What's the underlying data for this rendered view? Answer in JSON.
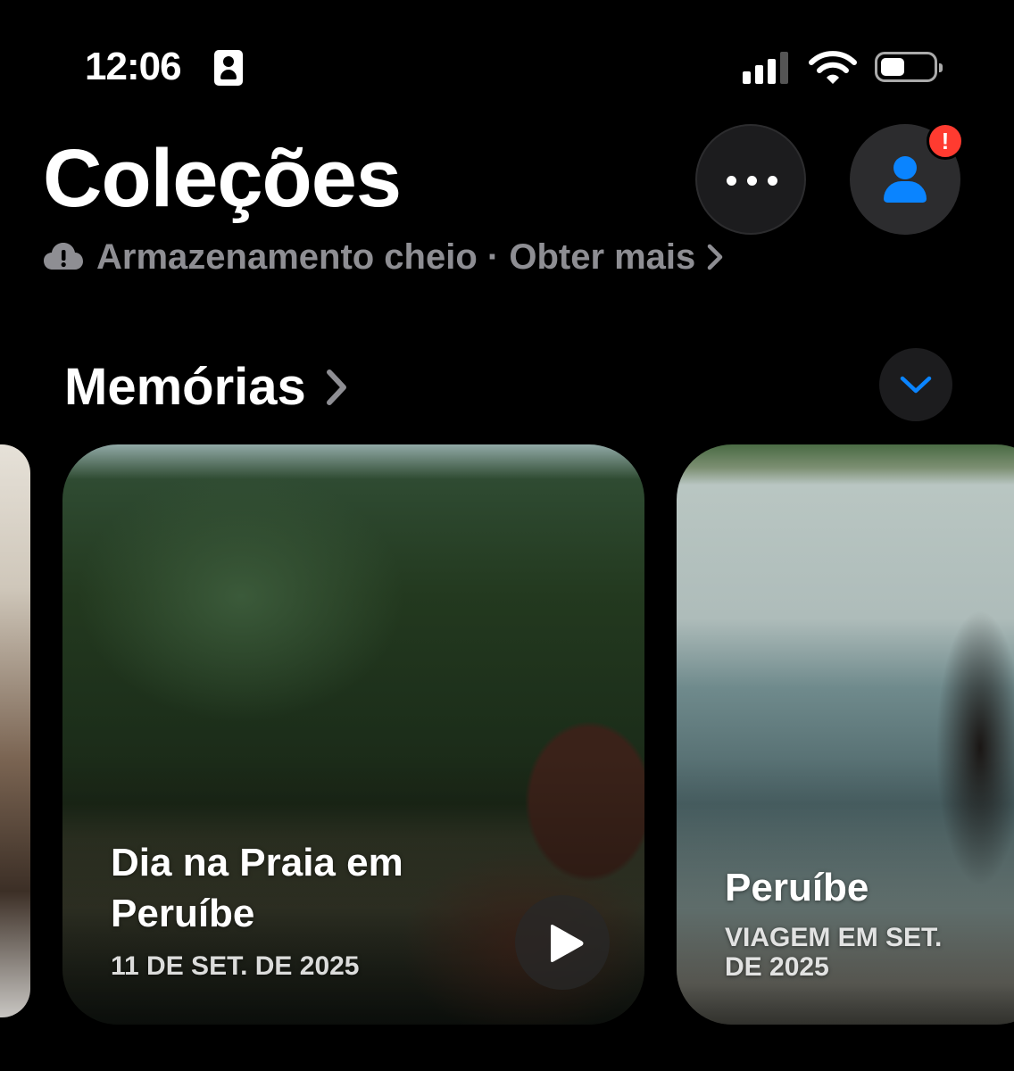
{
  "status_bar": {
    "time": "12:06",
    "icons": [
      "contact-card-icon",
      "cellular-signal-icon",
      "wifi-icon",
      "battery-icon"
    ],
    "battery_level": 0.4
  },
  "header": {
    "title": "Coleções",
    "more_icon": "ellipsis-icon",
    "account_icon": "person-icon",
    "badge": "!"
  },
  "storage": {
    "text": "Armazenamento cheio · Obter mais",
    "icon": "cloud-alert-icon"
  },
  "section": {
    "title": "Memórias",
    "collapse_icon": "chevron-down-icon"
  },
  "memories": [
    {
      "title": "Dia na Praia em Peruíbe",
      "subtitle": "11 DE SET. DE 2025",
      "has_play": true
    },
    {
      "title": "Peruíbe",
      "subtitle": "VIAGEM EM SET. DE 2025",
      "has_play": false
    }
  ],
  "colors": {
    "background": "#000000",
    "accent": "#0a84ff",
    "secondary_text": "#8e8e93",
    "badge": "#ff3b30"
  }
}
